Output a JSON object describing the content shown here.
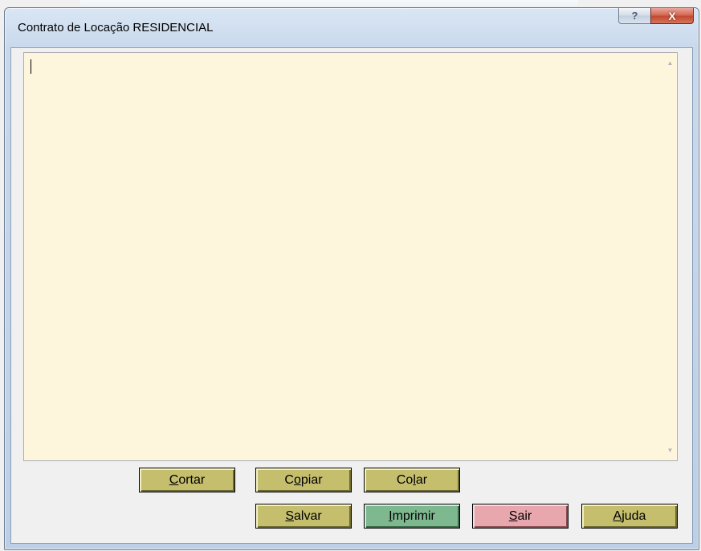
{
  "window": {
    "title": "Contrato de Locação RESIDENCIAL",
    "help_label": "?",
    "close_label": "X"
  },
  "editor": {
    "value": ""
  },
  "buttons": {
    "cortar": {
      "pre": "",
      "key": "C",
      "post": "ortar"
    },
    "copiar": {
      "pre": "C",
      "key": "o",
      "post": "piar"
    },
    "colar": {
      "pre": "Co",
      "key": "l",
      "post": "ar"
    },
    "salvar": {
      "pre": "",
      "key": "S",
      "post": "alvar"
    },
    "imprimir": {
      "pre": "",
      "key": "I",
      "post": "mprimir"
    },
    "sair": {
      "pre": "",
      "key": "S",
      "post": "air"
    },
    "ajuda": {
      "pre": "",
      "key": "A",
      "post": "juda"
    }
  },
  "colors": {
    "button_yellow": "#c4be6d",
    "button_green": "#7eb88f",
    "button_pink": "#e8a6ad",
    "editor_background": "#fdf5dc"
  },
  "icons": {
    "scroll_up": "triangle-up",
    "scroll_down": "triangle-down"
  }
}
